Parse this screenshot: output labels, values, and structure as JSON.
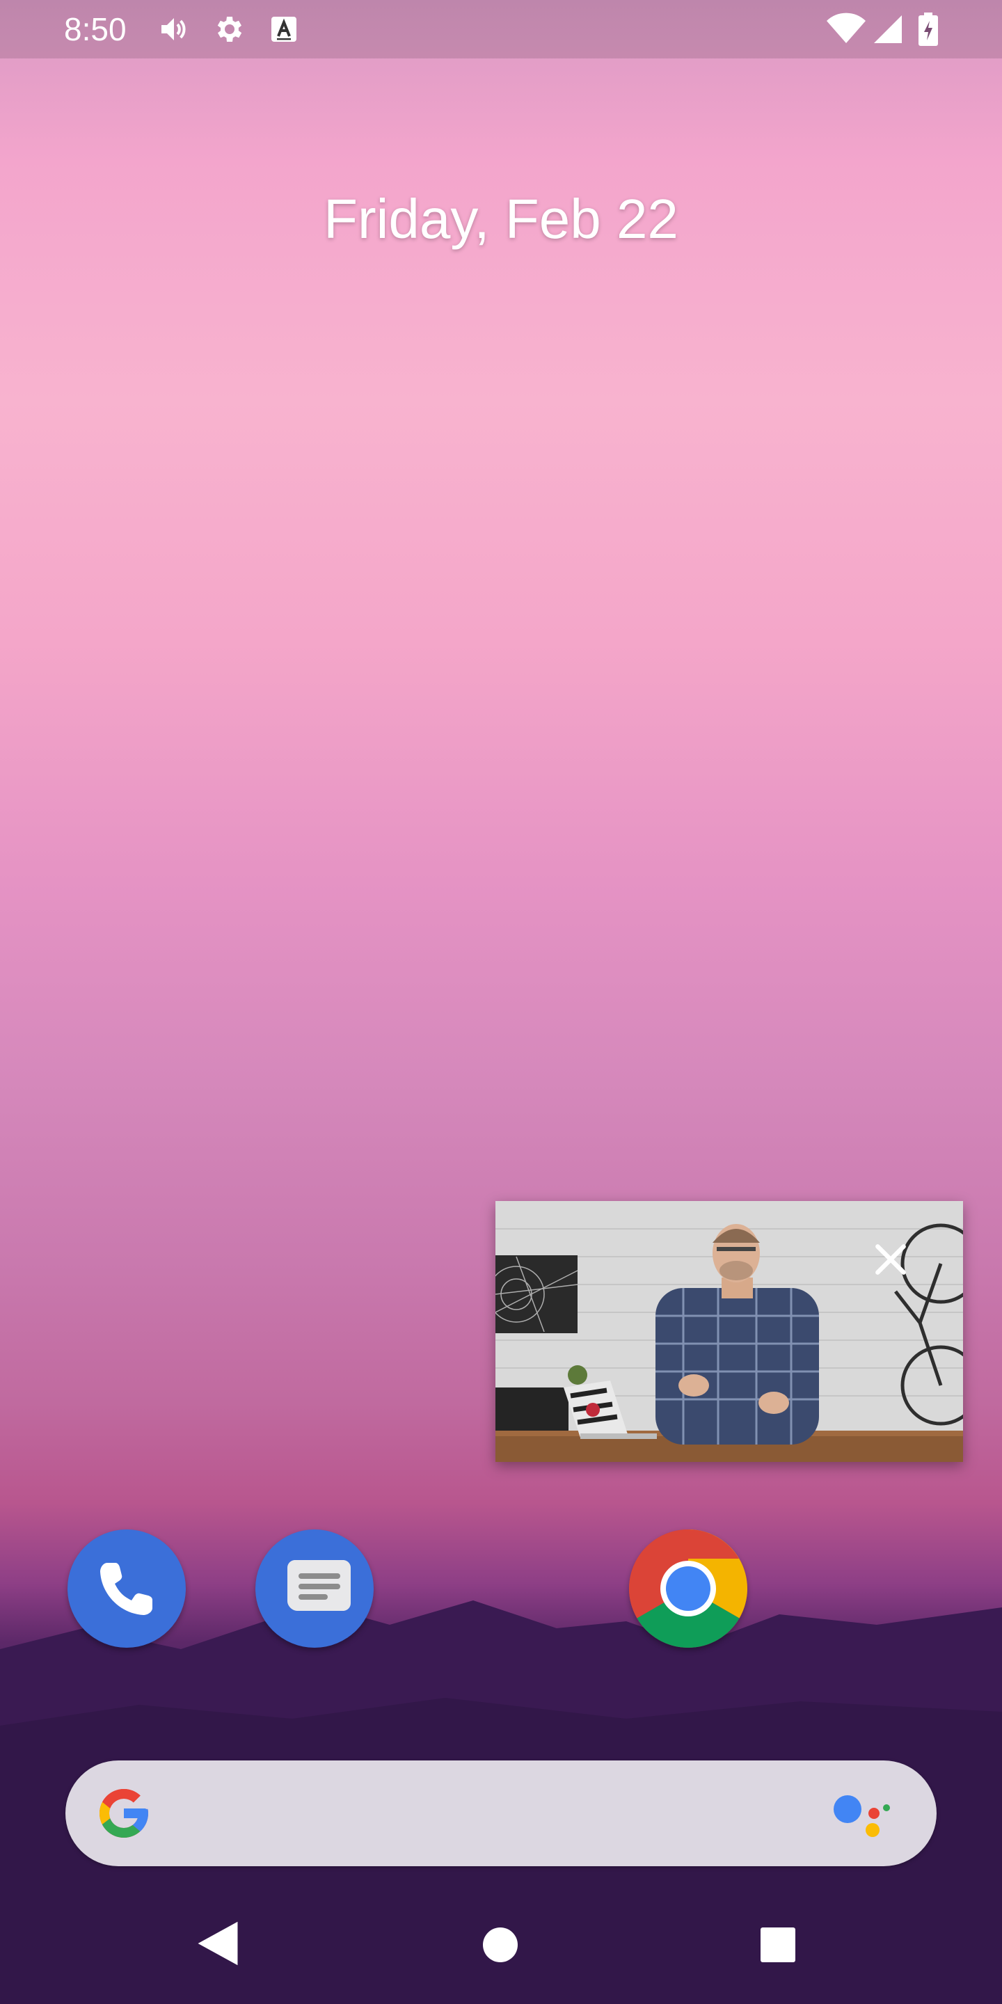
{
  "status_bar": {
    "time": "8:50",
    "left_icons": [
      "volume-icon",
      "settings-gear-icon",
      "keyboard-a-icon"
    ],
    "right_icons": [
      "wifi-icon",
      "cellular-signal-icon",
      "battery-charging-icon"
    ]
  },
  "home": {
    "date": "Friday, Feb 22"
  },
  "pip": {
    "content": "video-thumbnail-presenter",
    "close_icon": "close-icon"
  },
  "dock": {
    "apps": [
      {
        "icon": "phone-icon",
        "color": "#3b6fd9"
      },
      {
        "icon": "messages-icon",
        "color": "#3b6fd9"
      },
      {
        "icon": "chrome-icon",
        "color": "#4285f4"
      }
    ]
  },
  "search": {
    "logo_icon": "google-g-icon",
    "assistant_icon": "google-assistant-icon",
    "placeholder": ""
  },
  "navigation": {
    "buttons": [
      "back-icon",
      "home-icon",
      "overview-icon"
    ]
  },
  "colors": {
    "wallpaper_top": "#f3a5cc",
    "wallpaper_bottom": "#2b1440",
    "search_bar": "#dcd7e1"
  }
}
